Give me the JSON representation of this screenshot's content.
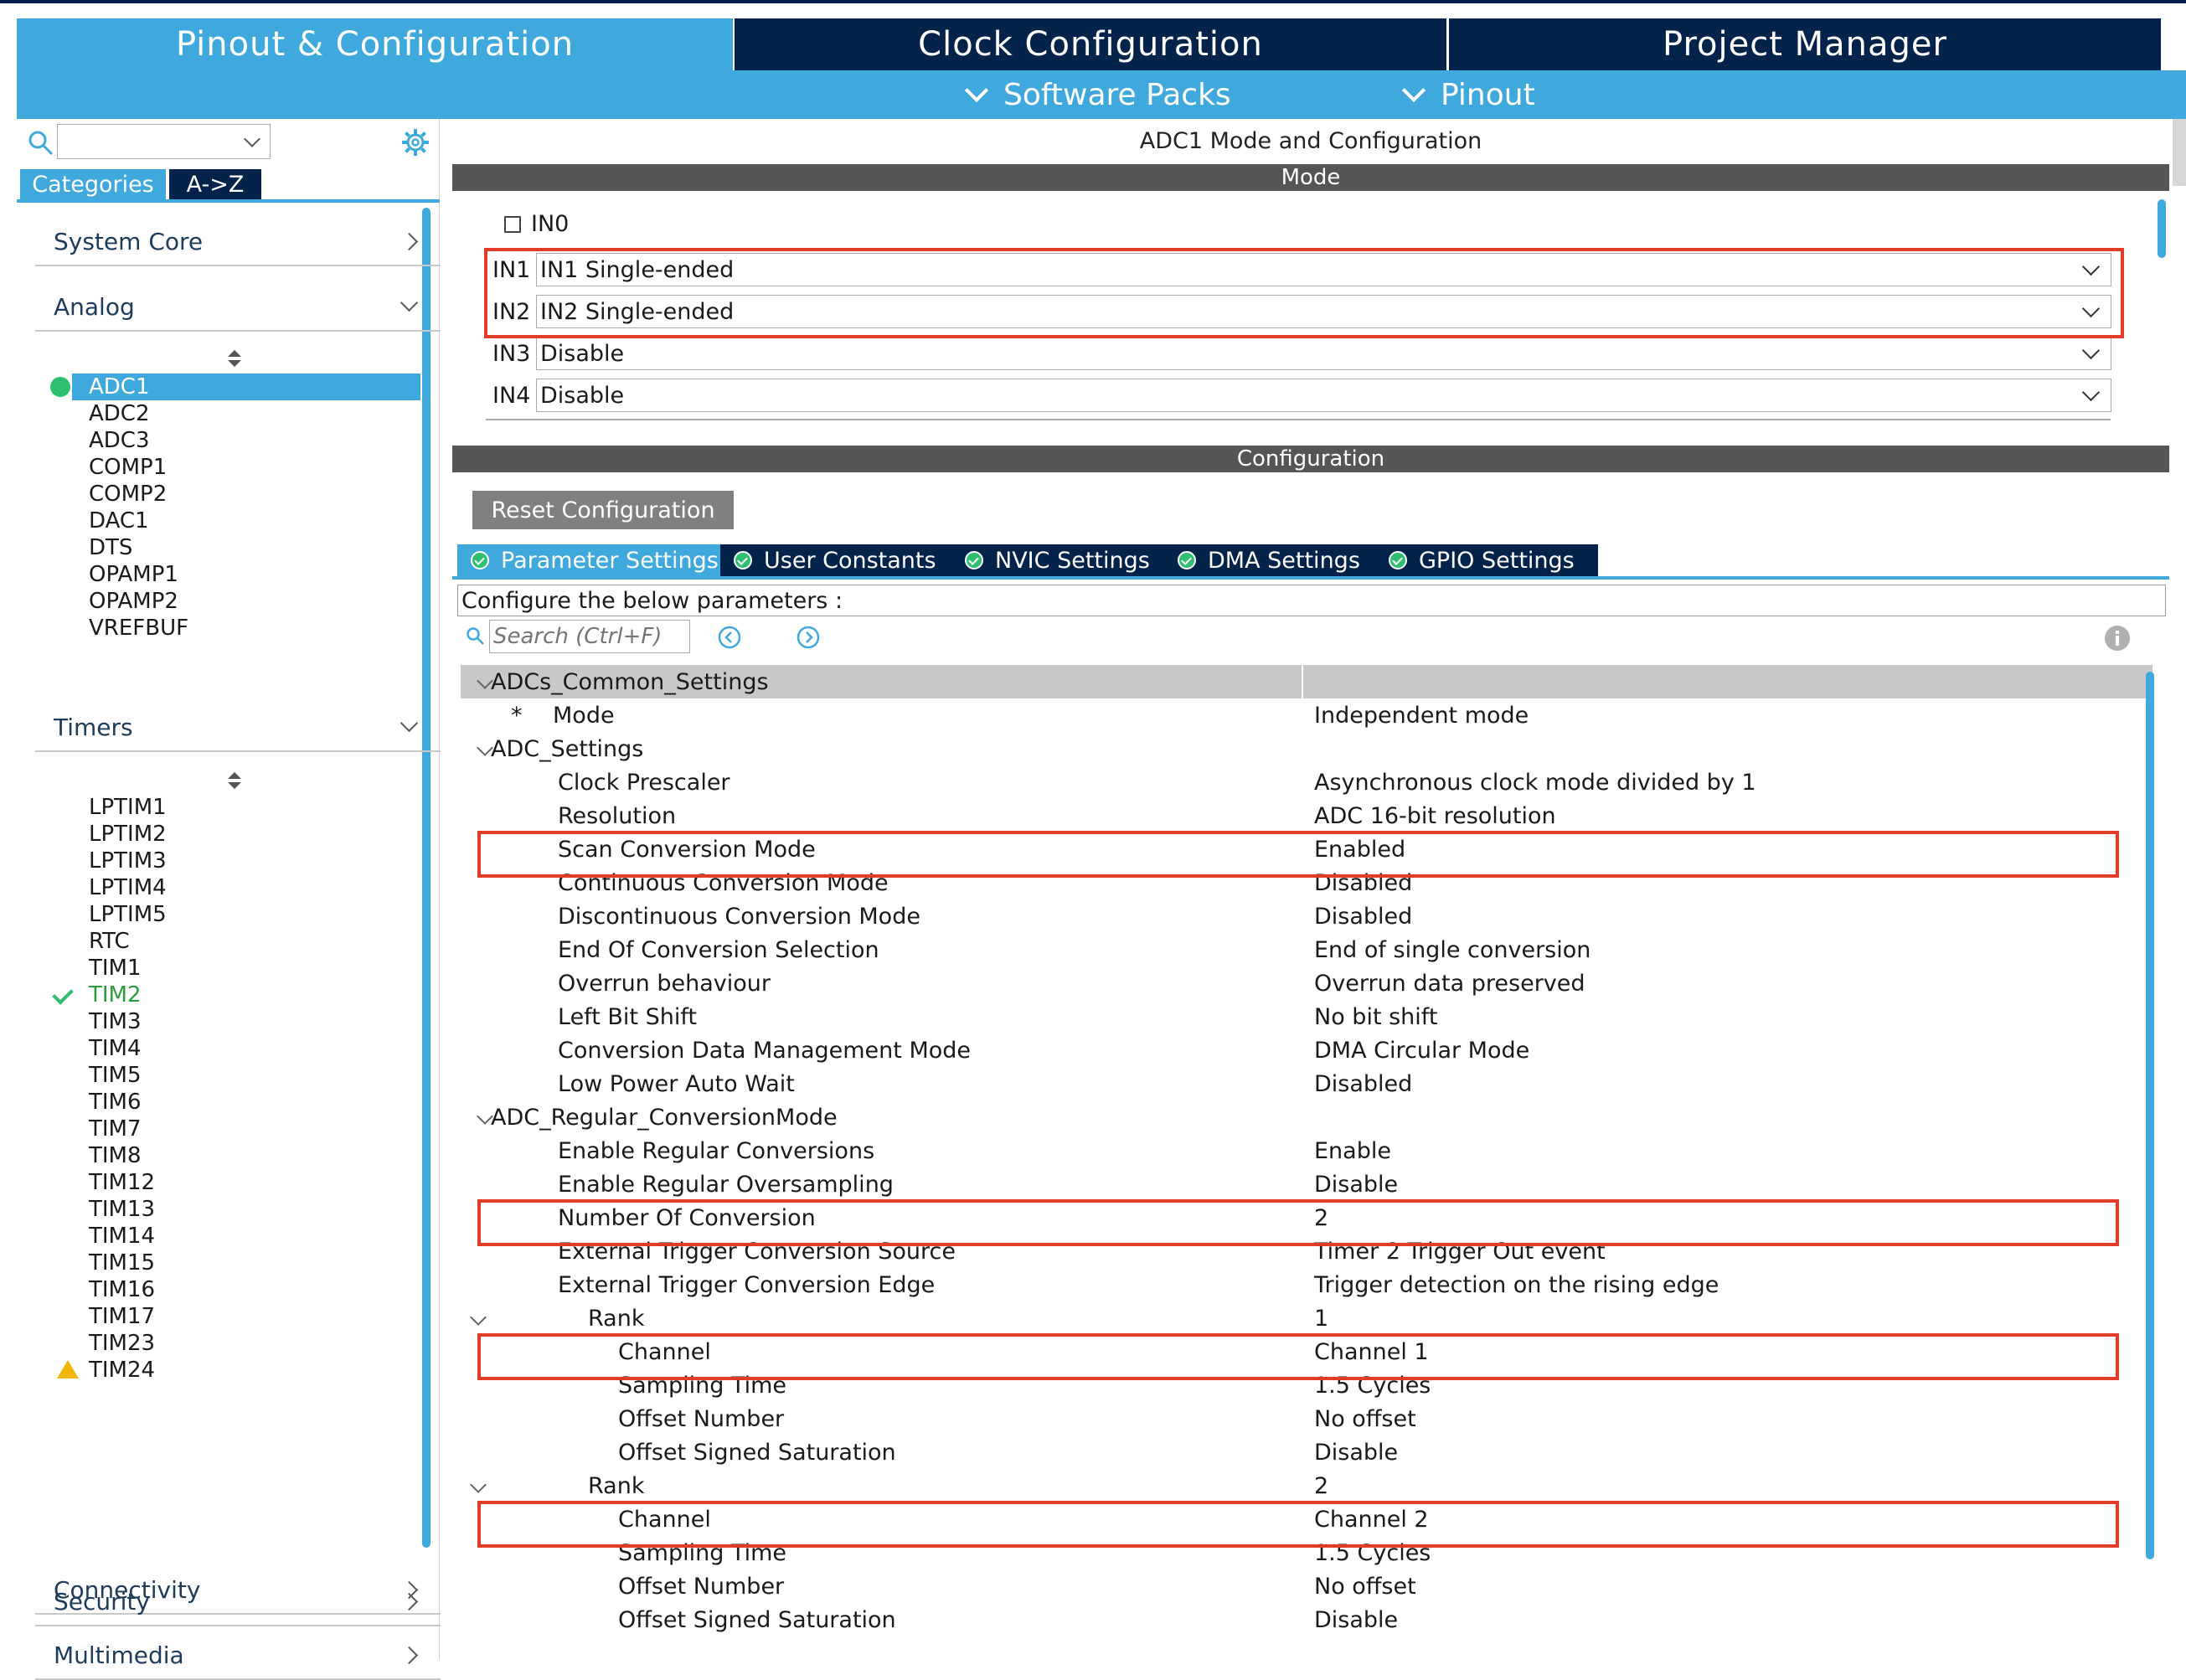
{
  "top_tabs": [
    "Pinout & Configuration",
    "Clock Configuration",
    "Project Manager"
  ],
  "sub_menus": [
    "Software Packs",
    "Pinout"
  ],
  "left_panel": {
    "tabs": [
      "Categories",
      "A->Z"
    ],
    "categories": {
      "system_core": "System Core",
      "analog": "Analog",
      "timers": "Timers",
      "connectivity": "Connectivity",
      "multimedia": "Multimedia",
      "security": "Security"
    },
    "analog_items": [
      "ADC1",
      "ADC2",
      "ADC3",
      "COMP1",
      "COMP2",
      "DAC1",
      "DTS",
      "OPAMP1",
      "OPAMP2",
      "VREFBUF"
    ],
    "timer_items": [
      "LPTIM1",
      "LPTIM2",
      "LPTIM3",
      "LPTIM4",
      "LPTIM5",
      "RTC",
      "TIM1",
      "TIM2",
      "TIM3",
      "TIM4",
      "TIM5",
      "TIM6",
      "TIM7",
      "TIM8",
      "TIM12",
      "TIM13",
      "TIM14",
      "TIM15",
      "TIM16",
      "TIM17",
      "TIM23",
      "TIM24"
    ]
  },
  "main": {
    "title": "ADC1 Mode and Configuration",
    "mode_header": "Mode",
    "in0_label": "IN0",
    "inputs": [
      {
        "label": "IN1",
        "value": "IN1 Single-ended"
      },
      {
        "label": "IN2",
        "value": "IN2 Single-ended"
      },
      {
        "label": "IN3",
        "value": "Disable"
      },
      {
        "label": "IN4",
        "value": "Disable"
      }
    ],
    "config_header": "Configuration",
    "reset_button": "Reset Configuration",
    "config_tabs": [
      "Parameter Settings",
      "User Constants",
      "NVIC Settings",
      "DMA Settings",
      "GPIO Settings"
    ],
    "configure_text": "Configure the below parameters :",
    "search_placeholder": "Search (Ctrl+F)"
  },
  "params": [
    {
      "name": "ADCs_Common_Settings",
      "value": "",
      "level": 0,
      "group": true
    },
    {
      "name": "Mode",
      "value": "Independent mode",
      "level": 1,
      "star": "*"
    },
    {
      "name": "ADC_Settings",
      "value": "",
      "level": 0,
      "group": true
    },
    {
      "name": "Clock Prescaler",
      "value": "Asynchronous clock mode divided by 1",
      "level": 1
    },
    {
      "name": "Resolution",
      "value": "ADC 16-bit resolution",
      "level": 1
    },
    {
      "name": "Scan Conversion Mode",
      "value": "Enabled",
      "level": 1
    },
    {
      "name": "Continuous Conversion Mode",
      "value": "Disabled",
      "level": 1
    },
    {
      "name": "Discontinuous Conversion Mode",
      "value": "Disabled",
      "level": 1
    },
    {
      "name": "End Of Conversion Selection",
      "value": "End of single conversion",
      "level": 1
    },
    {
      "name": "Overrun behaviour",
      "value": "Overrun data preserved",
      "level": 1
    },
    {
      "name": "Left Bit Shift",
      "value": "No bit shift",
      "level": 1
    },
    {
      "name": "Conversion Data Management Mode",
      "value": "DMA Circular Mode",
      "level": 1
    },
    {
      "name": "Low Power Auto Wait",
      "value": "Disabled",
      "level": 1
    },
    {
      "name": "ADC_Regular_ConversionMode",
      "value": "",
      "level": 0,
      "group": true
    },
    {
      "name": "Enable Regular Conversions",
      "value": "Enable",
      "level": 1
    },
    {
      "name": "Enable Regular Oversampling",
      "value": "Disable",
      "level": 1
    },
    {
      "name": "Number Of Conversion",
      "value": "2",
      "level": 1
    },
    {
      "name": "External Trigger Conversion Source",
      "value": "Timer 2 Trigger Out event",
      "level": 1
    },
    {
      "name": "External Trigger Conversion Edge",
      "value": "Trigger detection on the rising edge",
      "level": 1
    },
    {
      "name": "Rank",
      "value": "1",
      "level": 2,
      "group": true
    },
    {
      "name": "Channel",
      "value": "Channel 1",
      "level": 3
    },
    {
      "name": "Sampling Time",
      "value": "1.5 Cycles",
      "level": 3
    },
    {
      "name": "Offset Number",
      "value": "No offset",
      "level": 3
    },
    {
      "name": "Offset Signed Saturation",
      "value": "Disable",
      "level": 3
    },
    {
      "name": "Rank",
      "value": "2",
      "level": 2,
      "group": true
    },
    {
      "name": "Channel",
      "value": "Channel 2",
      "level": 3
    },
    {
      "name": "Sampling Time",
      "value": "1.5 Cycles",
      "level": 3
    },
    {
      "name": "Offset Number",
      "value": "No offset",
      "level": 3
    },
    {
      "name": "Offset Signed Saturation",
      "value": "Disable",
      "level": 3
    }
  ],
  "colors": {
    "accent": "#3fa9dd",
    "navy": "#03234b",
    "highlight": "#e23b2a",
    "ok": "#2a9d3a"
  }
}
